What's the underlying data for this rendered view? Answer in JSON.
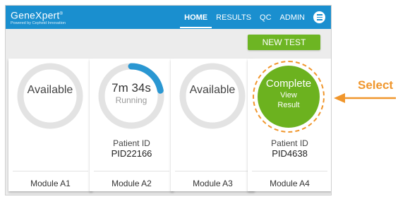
{
  "brand": {
    "name": "GeneXpert",
    "trademark": "®",
    "tagline": "Powered by Cepheid Innovation"
  },
  "nav": {
    "items": [
      {
        "label": "HOME",
        "active": true
      },
      {
        "label": "RESULTS"
      },
      {
        "label": "QC"
      },
      {
        "label": "ADMIN"
      }
    ],
    "menu_icon": "hamburger-menu-icon"
  },
  "actions": {
    "new_test": "NEW TEST"
  },
  "modules": [
    {
      "status": "Available",
      "name": "Module A1"
    },
    {
      "time": "7m 34s",
      "status": "Running",
      "progress": 0.22,
      "patient_label": "Patient ID",
      "patient_id": "PID22166",
      "name": "Module A2"
    },
    {
      "status": "Available",
      "name": "Module A3"
    },
    {
      "status": "Complete",
      "action_line1": "View",
      "action_line2": "Result",
      "patient_label": "Patient ID",
      "patient_id": "PID4638",
      "name": "Module A4"
    }
  ],
  "callout": {
    "label": "Select",
    "icon": "arrow-left-icon"
  },
  "colors": {
    "header": "#1a8fcf",
    "green": "#6cb21f",
    "ring_gray": "#e3e3e3",
    "progress_blue": "#2a97d2",
    "orange": "#f0962c"
  }
}
